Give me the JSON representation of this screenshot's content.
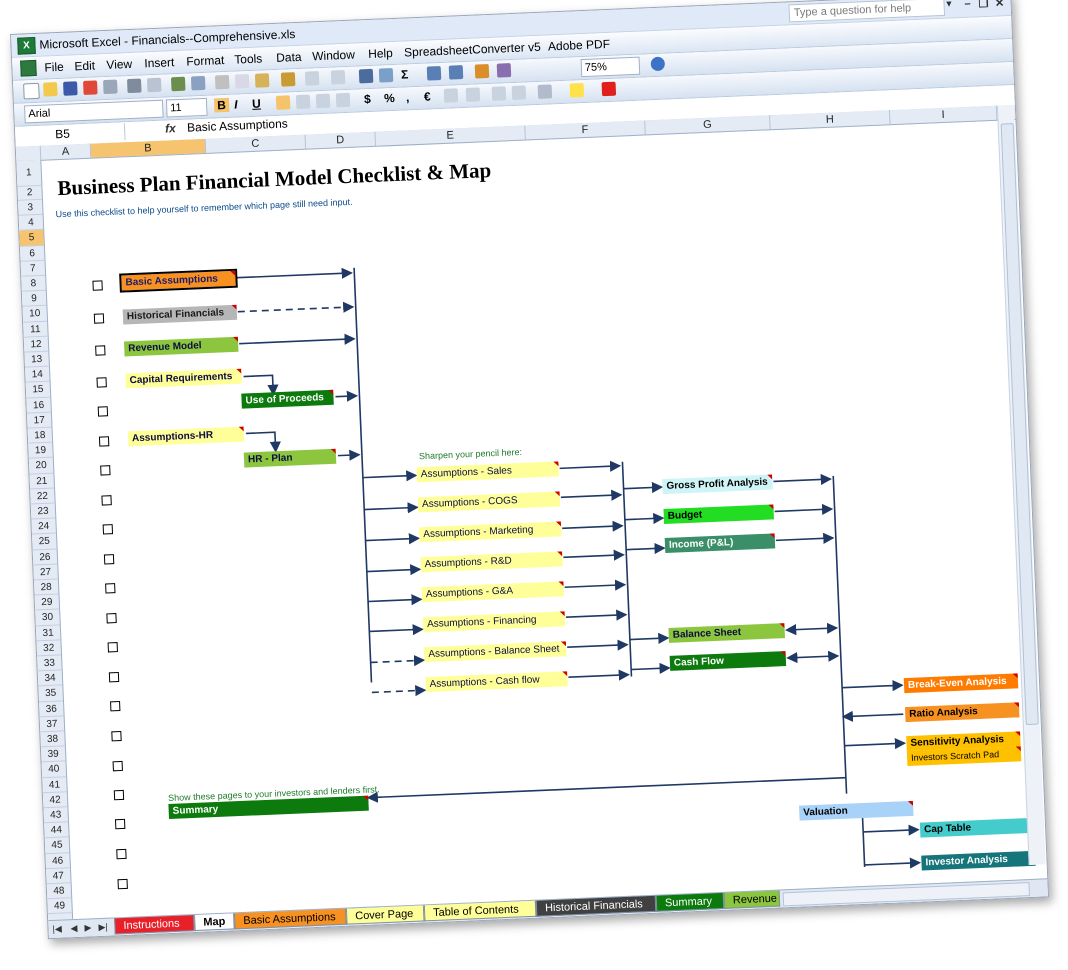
{
  "window": {
    "title": "Microsoft Excel - Financials--Comprehensive.xls",
    "help_placeholder": "Type a question for help",
    "controls": [
      "minimize-icon",
      "restore-icon",
      "close-icon"
    ]
  },
  "menu": [
    "File",
    "Edit",
    "View",
    "Insert",
    "Format",
    "Tools",
    "Data",
    "Window",
    "Help",
    "SpreadsheetConverter v5",
    "Adobe PDF"
  ],
  "toolbar": {
    "zoom": "75%",
    "font_name": "Arial",
    "font_size": "11",
    "bold": "B",
    "italic": "I",
    "underline": "U",
    "currency": "$",
    "percent": "%",
    "comma": ",",
    "euro": "€"
  },
  "formula_bar": {
    "name_box": "B5",
    "fx": "fx",
    "value": "Basic Assumptions"
  },
  "columns": [
    "A",
    "B",
    "C",
    "D",
    "E",
    "F",
    "G",
    "H",
    "I"
  ],
  "rows": [
    "1",
    "2",
    "3",
    "4",
    "5",
    "6",
    "7",
    "8",
    "9",
    "10",
    "11",
    "12",
    "13",
    "14",
    "15",
    "16",
    "17",
    "18",
    "19",
    "20",
    "21",
    "22",
    "23",
    "24",
    "25",
    "26",
    "27",
    "28",
    "29",
    "30",
    "31",
    "32",
    "33",
    "34",
    "35",
    "36",
    "37",
    "38",
    "39",
    "40",
    "41",
    "42",
    "43",
    "44",
    "45",
    "46",
    "47",
    "48",
    "49"
  ],
  "sheet": {
    "title": "Business Plan Financial Model Checklist & Map",
    "subtitle": "Use this checklist to help yourself to remember which page still need input.",
    "pencil_note": "Sharpen your pencil here:",
    "investor_note": "Show these pages to your investors and lenders first.",
    "boxes": {
      "basic_assumptions": "Basic Assumptions",
      "historical_financials": "Historical Financials",
      "revenue_model": "Revenue Model",
      "capital_requirements": "Capital Requirements",
      "use_of_proceeds": "Use of Proceeds",
      "assumptions_hr": "Assumptions-HR",
      "hr_plan": "HR - Plan",
      "assumptions_sales": "Assumptions - Sales",
      "assumptions_cogs": "Assumptions - COGS",
      "assumptions_marketing": "Assumptions - Marketing",
      "assumptions_rd": "Assumptions - R&D",
      "assumptions_ga": "Assumptions - G&A",
      "assumptions_financing": "Assumptions - Financing",
      "assumptions_balance_sheet": "Assumptions - Balance Sheet",
      "assumptions_cash_flow": "Assumptions - Cash flow",
      "gross_profit_analysis": "Gross Profit Analysis",
      "budget": "Budget",
      "income_pl": "Income (P&L)",
      "balance_sheet": "Balance Sheet",
      "cash_flow": "Cash Flow",
      "break_even_analysis": "Break-Even Analysis",
      "ratio_analysis": "Ratio Analysis",
      "sensitivity_analysis": "Sensitivity Analysis",
      "investors_scratch_pad": "Investors Scratch Pad",
      "valuation": "Valuation",
      "cap_table": "Cap Table",
      "investor_analysis": "Investor Analysis",
      "summary": "Summary"
    }
  },
  "tabs": [
    {
      "label": "Instructions",
      "color": "#e8202a"
    },
    {
      "label": "Map",
      "color": "#ffffff"
    },
    {
      "label": "Basic Assumptions",
      "color": "#f79122"
    },
    {
      "label": "Cover Page",
      "color": "#ffff99"
    },
    {
      "label": "Table of Contents",
      "color": "#ffff99"
    },
    {
      "label": "Historical Financials",
      "color": "#404040"
    },
    {
      "label": "Summary",
      "color": "#0c7a0c"
    },
    {
      "label": "Revenue",
      "color": "#8cc63f"
    }
  ]
}
